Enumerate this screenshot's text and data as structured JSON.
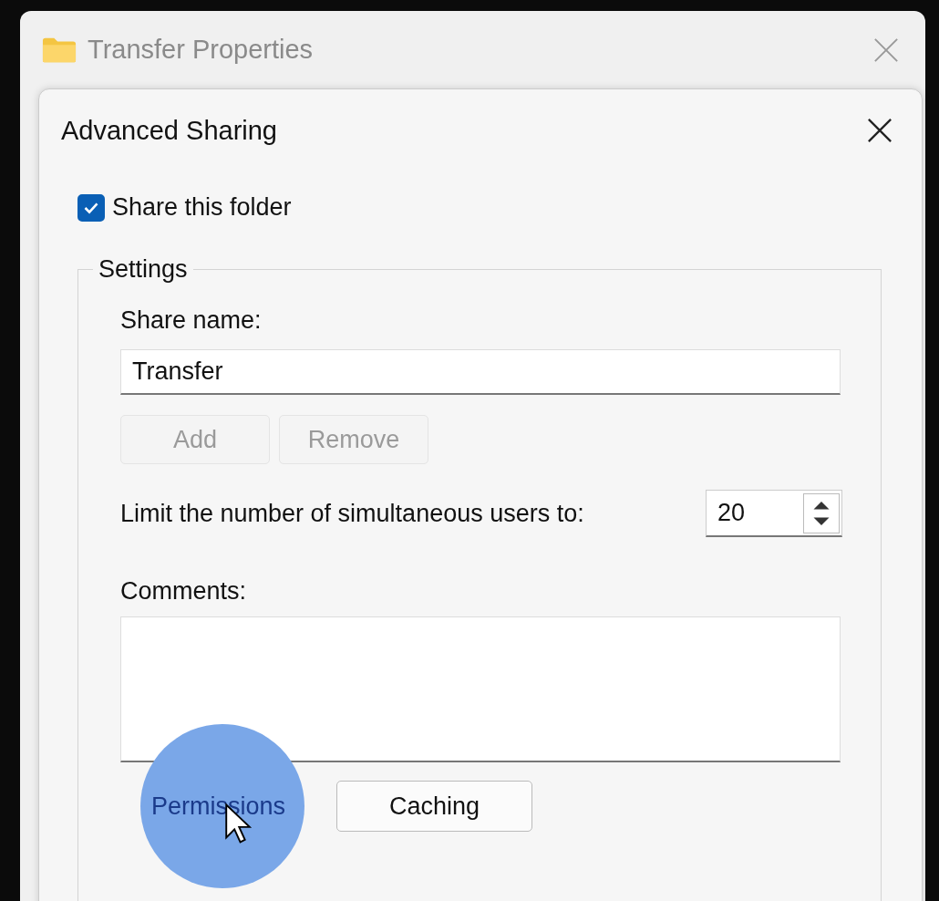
{
  "outer_window": {
    "title": "Transfer Properties"
  },
  "dialog": {
    "title": "Advanced Sharing",
    "share_checkbox": {
      "label": "Share this folder",
      "checked": true
    },
    "settings": {
      "legend": "Settings",
      "share_name": {
        "label": "Share name:",
        "value": "Transfer"
      },
      "buttons": [
        {
          "label": "Add",
          "disabled": true
        },
        {
          "label": "Remove",
          "disabled": true
        }
      ],
      "user_limit": {
        "label": "Limit the number of simultaneous users to:",
        "value": "20"
      },
      "comments": {
        "label": "Comments:"
      },
      "bottom_buttons": [
        {
          "label": "Permissions",
          "clicked": true
        },
        {
          "label": "Caching",
          "clicked": false
        }
      ]
    }
  }
}
